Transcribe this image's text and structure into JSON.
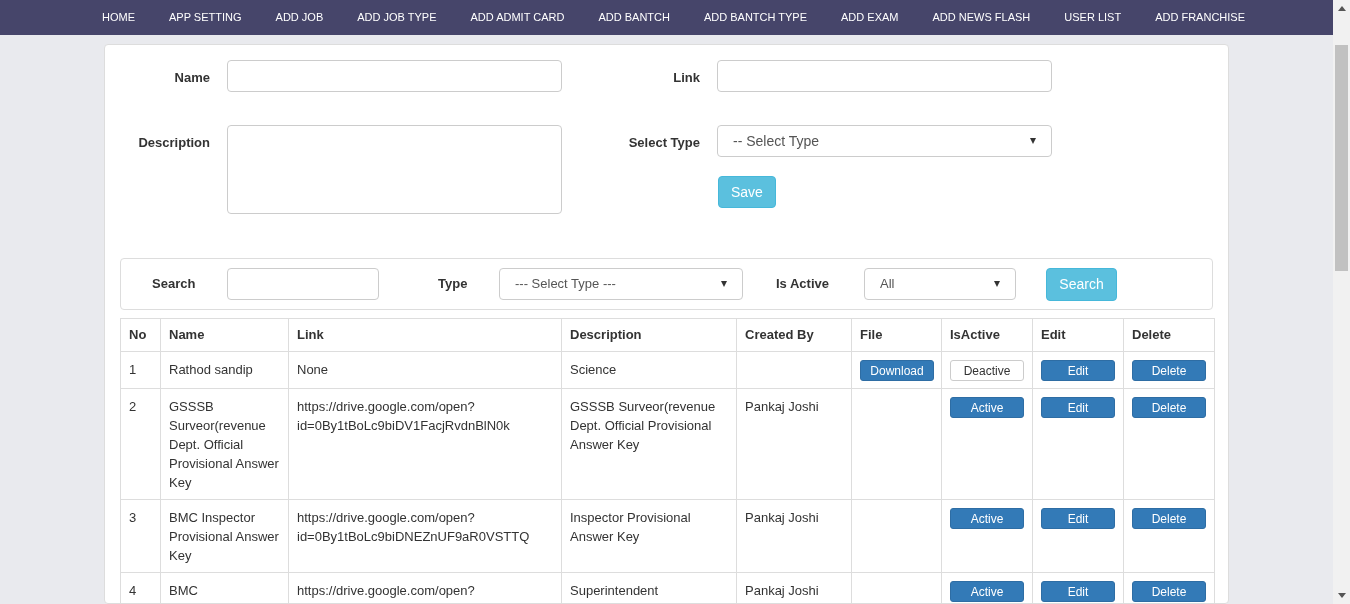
{
  "nav": [
    "HOME",
    "APP SETTING",
    "ADD JOB",
    "ADD JOB TYPE",
    "ADD ADMIT CARD",
    "ADD BANTCH",
    "ADD BANTCH TYPE",
    "ADD EXAM",
    "ADD NEWS FLASH",
    "USER LIST",
    "ADD FRANCHISE"
  ],
  "form": {
    "name_label": "Name",
    "link_label": "Link",
    "description_label": "Description",
    "type_label": "Select Type",
    "type_value": "-- Select Type",
    "save_button": "Save"
  },
  "filter": {
    "search_label": "Search",
    "type_label": "Type",
    "type_value": "--- Select Type ---",
    "active_label": "Is Active",
    "active_value": "All",
    "search_button": "Search"
  },
  "table": {
    "columns": [
      "No",
      "Name",
      "Link",
      "Description",
      "Created By",
      "File",
      "IsActive",
      "Edit",
      "Delete"
    ],
    "rows": [
      {
        "no": "1",
        "name": "Rathod sandip",
        "link": "None",
        "description": "Science",
        "created_by": "",
        "file_button": "Download",
        "status_button": {
          "label": "Deactive",
          "is_active": true
        },
        "edit": "Edit",
        "delete": "Delete"
      },
      {
        "no": "2",
        "name": "GSSSB Surveor(revenue Dept. Official Provisional Answer Key",
        "link": "https://drive.google.com/open?id=0By1tBoLc9biDV1FacjRvdnBlN0k",
        "description": "GSSSB Surveor(revenue Dept. Official Provisional Answer Key",
        "created_by": "Pankaj Joshi",
        "status_button": {
          "label": "Active",
          "is_active": false
        },
        "edit": "Edit",
        "delete": "Delete"
      },
      {
        "no": "3",
        "name": "BMC Inspector Provisional Answer Key",
        "link": "https://drive.google.com/open?id=0By1tBoLc9biDNEZnUF9aR0VSTTQ",
        "description": "Inspector Provisional Answer Key",
        "created_by": "Pankaj Joshi",
        "status_button": {
          "label": "Active",
          "is_active": false
        },
        "edit": "Edit",
        "delete": "Delete"
      },
      {
        "no": "4",
        "name": "BMC",
        "link": "https://drive.google.com/open?",
        "description": "Superintendent",
        "created_by": "Pankaj Joshi",
        "status_button": {
          "label": "Active",
          "is_active": false
        },
        "edit": "Edit",
        "delete": "Delete"
      }
    ]
  }
}
